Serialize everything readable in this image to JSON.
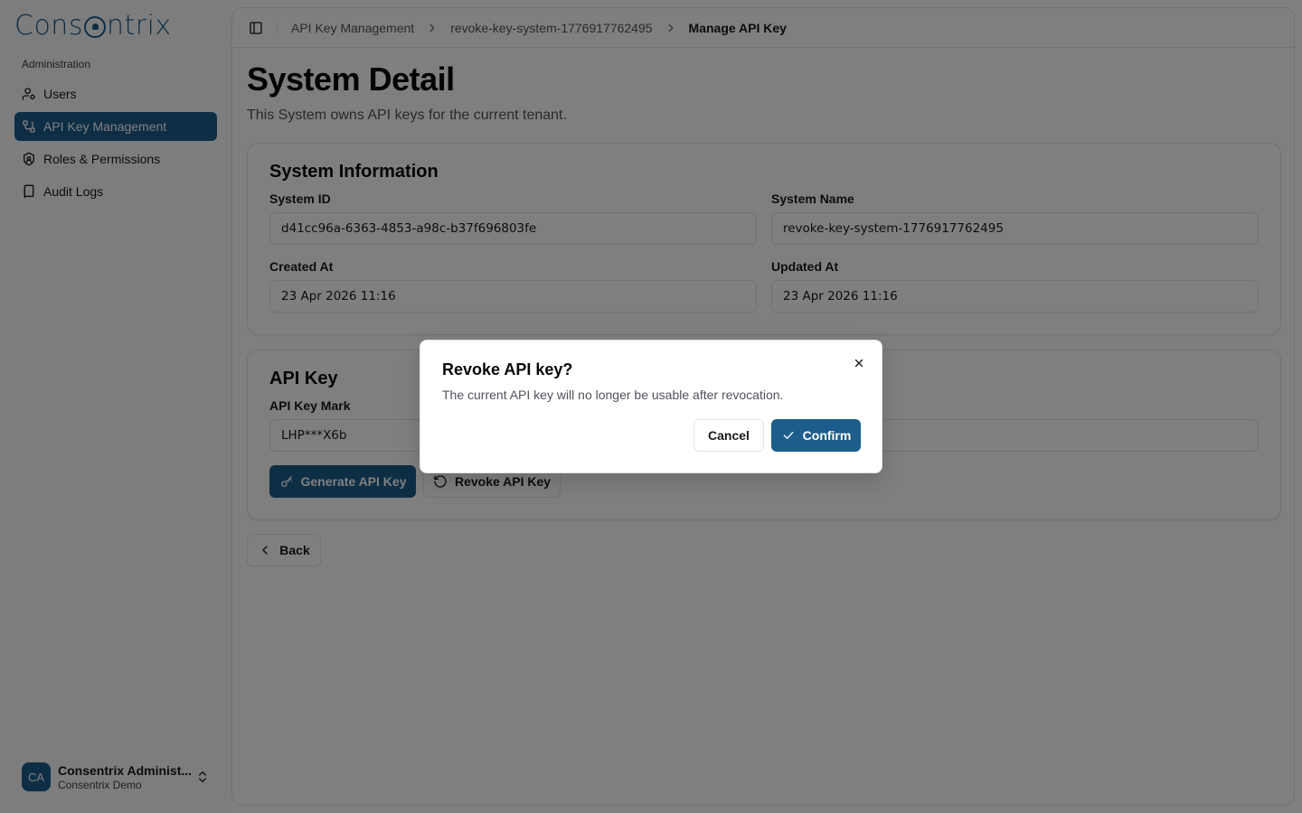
{
  "brand": {
    "name": "Consentrix",
    "accent": "#1c5d8c"
  },
  "sidebar": {
    "section_label": "Administration",
    "items": [
      {
        "label": "Users",
        "icon": "user-cog-icon",
        "active": false
      },
      {
        "label": "API Key Management",
        "icon": "workflow-icon",
        "active": true
      },
      {
        "label": "Roles & Permissions",
        "icon": "shield-icon",
        "active": false
      },
      {
        "label": "Audit Logs",
        "icon": "book-icon",
        "active": false
      }
    ],
    "user": {
      "initials": "CA",
      "name": "Consentrix Administ...",
      "org": "Consentrix Demo"
    }
  },
  "breadcrumb": {
    "items": [
      "API Key Management",
      "revoke-key-system-1776917762495",
      "Manage API Key"
    ]
  },
  "page": {
    "title": "System Detail",
    "subtitle": "This System owns API keys for the current tenant."
  },
  "system_info": {
    "title": "System Information",
    "system_id_label": "System ID",
    "system_id": "d41cc96a-6363-4853-a98c-b37f696803fe",
    "system_name_label": "System Name",
    "system_name": "revoke-key-system-1776917762495",
    "created_at_label": "Created At",
    "created_at": "23 Apr 2026 11:16",
    "updated_at_label": "Updated At",
    "updated_at": "23 Apr 2026 11:16"
  },
  "api_key": {
    "title": "API Key",
    "mark_label": "API Key Mark",
    "mark_value": "LHP***X6b",
    "generate_label": "Generate API Key",
    "revoke_label": "Revoke API Key"
  },
  "back_label": "Back",
  "dialog": {
    "title": "Revoke API key?",
    "description": "The current API key will no longer be usable after revocation.",
    "cancel_label": "Cancel",
    "confirm_label": "Confirm"
  }
}
